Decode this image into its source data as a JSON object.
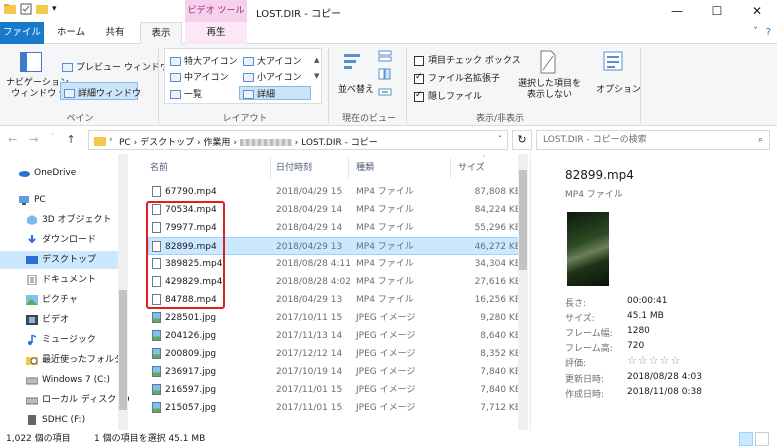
{
  "titlebar": {
    "context_tab_header": "ビデオ ツール",
    "title": "LOST.DIR - コピー",
    "minimize": "—",
    "maximize": "☐",
    "close": "✕"
  },
  "tabs": {
    "file": "ファイル",
    "home": "ホーム",
    "share": "共有",
    "view": "表示",
    "play": "再生"
  },
  "ribbon": {
    "nav_pane": "ナビゲーション\nウィンドウ ▾",
    "nav_pane_l1": "ナビゲーション",
    "nav_pane_l2": "ウィンドウ ▾",
    "preview_pane": "プレビュー ウィンドウ",
    "details_pane": "詳細ウィンドウ",
    "group_panes": "ペイン",
    "layout_items": [
      "特大アイコン",
      "大アイコン",
      "中アイコン",
      "小アイコン",
      "一覧",
      "詳細"
    ],
    "group_layout": "レイアウト",
    "sort_by": "並べ替え",
    "group_current_view": "現在のビュー",
    "item_checkbox": "項目チェック ボックス",
    "file_ext": "ファイル名拡張子",
    "hidden_items": "隠しファイル",
    "hide_selected_l1": "選択した項目を",
    "hide_selected_l2": "表示しない",
    "options": "オプション",
    "group_show_hide": "表示/非表示"
  },
  "address": {
    "path_pc": "PC",
    "path_desktop": "デスクトップ",
    "path_work": "作業用",
    "path_folder": "LOST.DIR - コピー",
    "search_placeholder": "LOST.DIR - コピーの検索"
  },
  "nav": {
    "items": [
      "OneDrive",
      "PC",
      "3D オブジェクト",
      "ダウンロード",
      "デスクトップ",
      "ドキュメント",
      "ピクチャ",
      "ビデオ",
      "ミュージック",
      "最近使ったフォルダ",
      "Windows 7 (C:)",
      "ローカル ディスク (D",
      "SDHC (F:)"
    ]
  },
  "columns": {
    "name": "名前",
    "date": "日付時刻",
    "type": "種類",
    "size": "サイズ"
  },
  "files": [
    {
      "name": "67790.mp4",
      "date": "2018/04/29 15",
      "type": "MP4 ファイル",
      "size": "87,808 KB"
    },
    {
      "name": "70534.mp4",
      "date": "2018/04/29 14",
      "type": "MP4 ファイル",
      "size": "84,224 KB"
    },
    {
      "name": "79977.mp4",
      "date": "2018/04/29 14",
      "type": "MP4 ファイル",
      "size": "55,296 KB"
    },
    {
      "name": "82899.mp4",
      "date": "2018/04/29 13",
      "type": "MP4 ファイル",
      "size": "46,272 KB"
    },
    {
      "name": "389825.mp4",
      "date": "2018/08/28 4:11",
      "type": "MP4 ファイル",
      "size": "34,304 KB"
    },
    {
      "name": "429829.mp4",
      "date": "2018/08/28 4:02",
      "type": "MP4 ファイル",
      "size": "27,616 KB"
    },
    {
      "name": "84788.mp4",
      "date": "2018/04/29 13",
      "type": "MP4 ファイル",
      "size": "16,256 KB"
    },
    {
      "name": "228501.jpg",
      "date": "2017/10/11 15",
      "type": "JPEG イメージ",
      "size": "9,280 KB"
    },
    {
      "name": "204126.jpg",
      "date": "2017/11/13 14",
      "type": "JPEG イメージ",
      "size": "8,640 KB"
    },
    {
      "name": "200809.jpg",
      "date": "2017/12/12 14",
      "type": "JPEG イメージ",
      "size": "8,352 KB"
    },
    {
      "name": "236917.jpg",
      "date": "2017/10/19 14",
      "type": "JPEG イメージ",
      "size": "7,840 KB"
    },
    {
      "name": "216597.jpg",
      "date": "2017/11/01 15",
      "type": "JPEG イメージ",
      "size": "7,840 KB"
    },
    {
      "name": "215057.jpg",
      "date": "2017/11/01 15",
      "type": "JPEG イメージ",
      "size": "7,712 KB"
    }
  ],
  "details": {
    "filename": "82899.mp4",
    "filetype": "MP4 ファイル",
    "props": [
      {
        "label": "長さ:",
        "value": "00:00:41"
      },
      {
        "label": "サイズ:",
        "value": "45.1 MB"
      },
      {
        "label": "フレーム幅:",
        "value": "1280"
      },
      {
        "label": "フレーム高:",
        "value": "720"
      },
      {
        "label": "評価:",
        "value": "☆☆☆☆☆"
      },
      {
        "label": "更新日時:",
        "value": "2018/08/28 4:03"
      },
      {
        "label": "作成日時:",
        "value": "2018/11/08 0:38"
      }
    ]
  },
  "status": {
    "count": "1,022 個の項目",
    "selected": "1 個の項目を選択  45.1 MB"
  }
}
